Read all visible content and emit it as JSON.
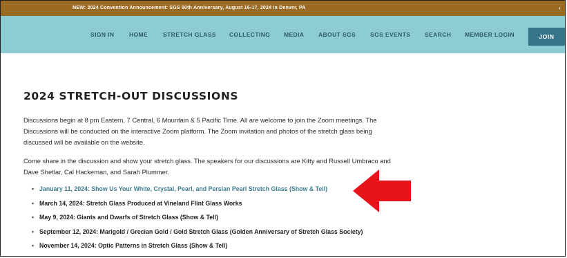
{
  "announcement": {
    "text": "NEW:  2024 Convention Announcement:  SGS 50th Anniversary, August 16-17, 2024 in Denver, PA",
    "arrow_glyph": "‹"
  },
  "nav": {
    "items": [
      {
        "name": "nav-sign-in",
        "label": "SIGN IN"
      },
      {
        "name": "nav-home",
        "label": "HOME"
      },
      {
        "name": "nav-stretch-glass",
        "label": "STRETCH GLASS"
      },
      {
        "name": "nav-collecting",
        "label": "COLLECTING"
      },
      {
        "name": "nav-media",
        "label": "MEDIA"
      },
      {
        "name": "nav-about-sgs",
        "label": "ABOUT SGS"
      },
      {
        "name": "nav-sgs-events",
        "label": "SGS EVENTS"
      },
      {
        "name": "nav-search",
        "label": "SEARCH"
      },
      {
        "name": "nav-member-login",
        "label": "MEMBER LOGIN"
      }
    ],
    "join_label": "JOIN"
  },
  "page": {
    "title": "2024 STRETCH-OUT DISCUSSIONS",
    "para1": "Discussions begin at 8 pm Eastern, 7 Central, 6 Mountain & 5 Pacific Time.  All are welcome to join the Zoom meetings.  The Discussions will be conducted on the interactive Zoom platform.  The Zoom invitation and photos of the stretch glass being discussed will be available on the website.",
    "para2": "Come share in the discussion and show your stretch glass.  The speakers for our discussions are Kitty and Russell Umbraco and Dave Shetlar, Cal Hackeman, and Sarah Plummer.",
    "discussions": [
      {
        "text": "January 11, 2024:  Show Us Your White, Crystal, Pearl, and Persian Pearl Stretch Glass (Show & Tell)",
        "is_link": true
      },
      {
        "text": "March 14, 2024:  Stretch Glass Produced at Vineland Flint Glass Works",
        "is_link": false
      },
      {
        "text": "May 9, 2024:  Giants and Dwarfs of Stretch Glass (Show & Tell)",
        "is_link": false
      },
      {
        "text": "September 12, 2024:  Marigold / Grecian Gold / Gold Stretch Glass (Golden Anniversary of Stretch Glass Society)",
        "is_link": false
      },
      {
        "text": "November 14, 2024:  Optic Patterns in Stretch Glass (Show & Tell)",
        "is_link": false
      }
    ]
  },
  "colors": {
    "announcement_bg": "#9a6a22",
    "nav_bg": "#8cccd2",
    "nav_text": "#2f5b66",
    "join_bg": "#37748a",
    "link": "#3d7c91",
    "arrow_red": "#e8141c"
  },
  "icons": {
    "annotation_arrow": "red-arrow-icon"
  }
}
